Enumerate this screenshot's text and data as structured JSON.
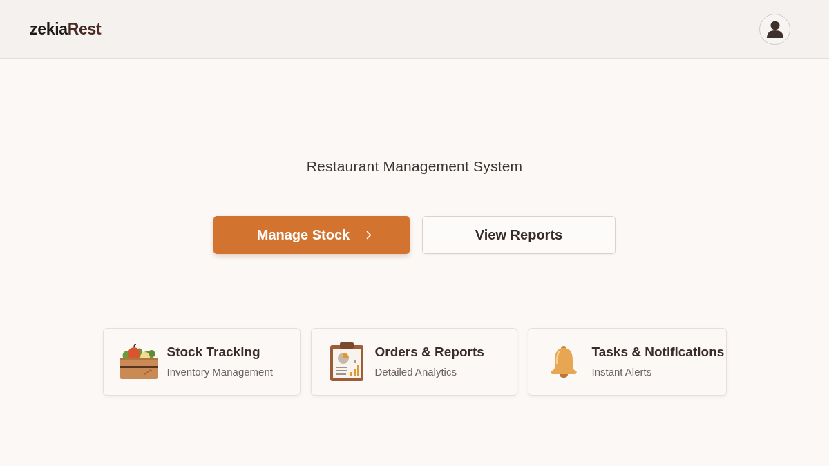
{
  "header": {
    "logo": {
      "text": "zekia",
      "accent": "Rest"
    }
  },
  "hero": {
    "subtitle": "Restaurant Management System",
    "buttons": [
      {
        "label": "Manage Stock",
        "kind": "primary"
      },
      {
        "label": "View Reports",
        "kind": "secondary"
      }
    ]
  },
  "features": [
    {
      "title": "Stock Tracking",
      "subtitle": "Inventory Management"
    },
    {
      "title": "Orders & Reports",
      "subtitle": "Detailed Analytics"
    },
    {
      "title": "Tasks & Notifications",
      "subtitle": "Instant Alerts"
    }
  ]
}
